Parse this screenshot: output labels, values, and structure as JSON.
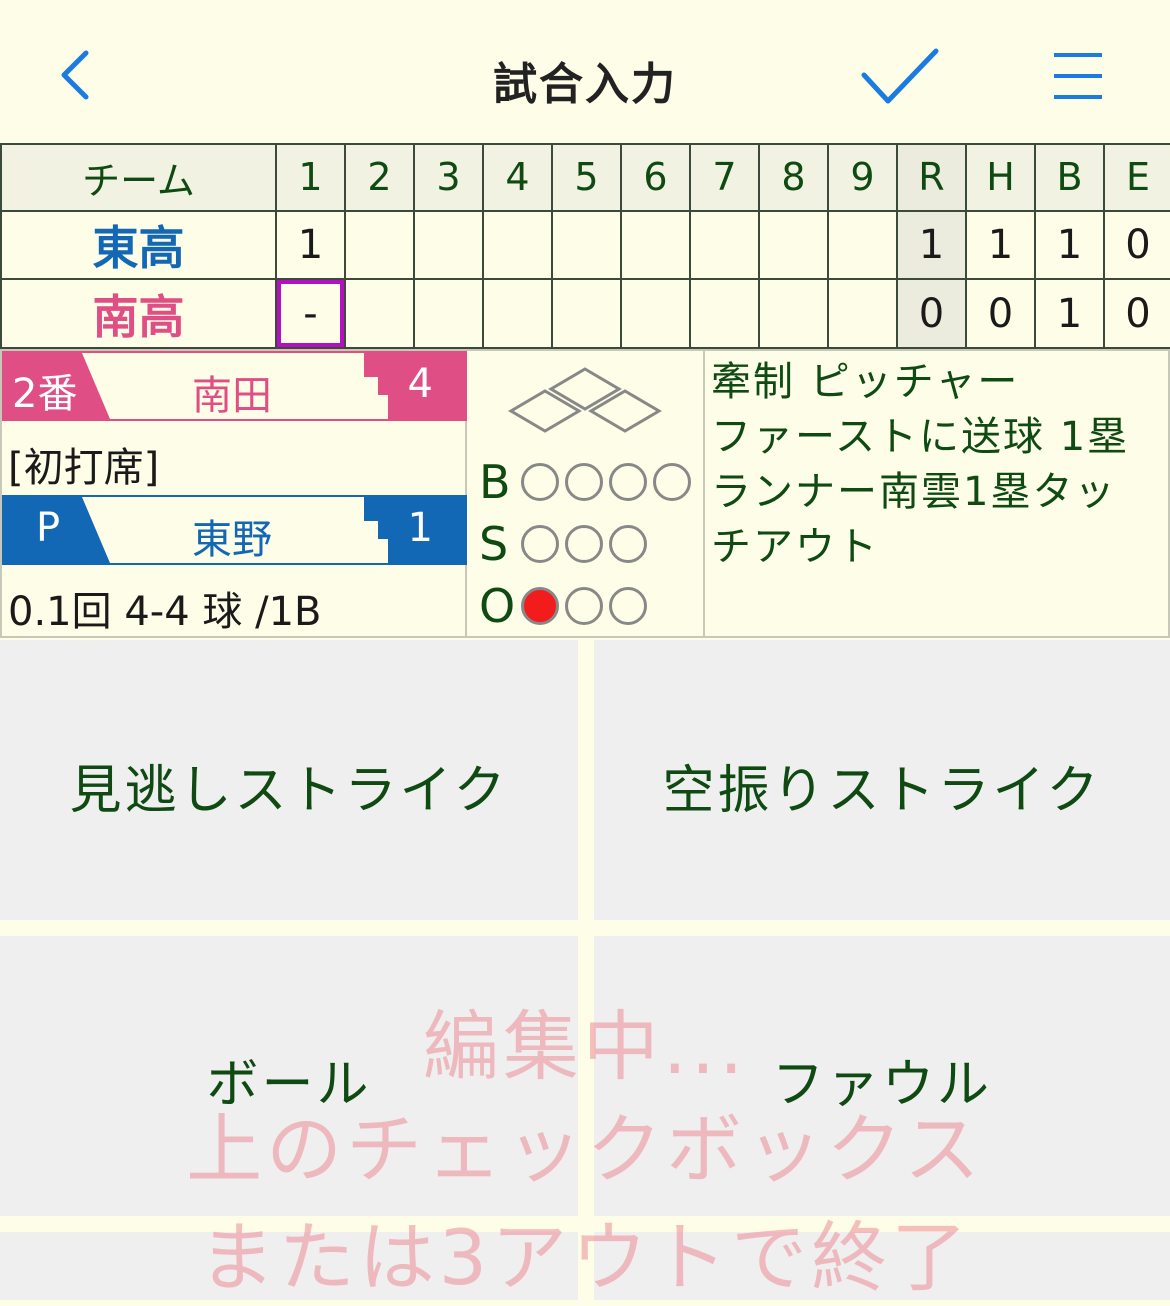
{
  "nav": {
    "title": "試合入力",
    "back_icon": "chevron-left-icon",
    "confirm_icon": "checkmark-icon",
    "menu_icon": "hamburger-menu-icon"
  },
  "scoreboard": {
    "headers": [
      "チーム",
      "1",
      "2",
      "3",
      "4",
      "5",
      "6",
      "7",
      "8",
      "9",
      "R",
      "H",
      "B",
      "E"
    ],
    "rows": [
      {
        "team": "東高",
        "innings": [
          "1",
          "",
          "",
          "",
          "",
          "",
          "",
          "",
          ""
        ],
        "R": "1",
        "H": "1",
        "B": "1",
        "E": "0"
      },
      {
        "team": "南高",
        "innings": [
          "-",
          "",
          "",
          "",
          "",
          "",
          "",
          "",
          ""
        ],
        "R": "0",
        "H": "0",
        "B": "1",
        "E": "0"
      }
    ]
  },
  "batter": {
    "order": "2番",
    "name": "南田",
    "position": "4",
    "note": "[初打席]"
  },
  "pitcher": {
    "label": "P",
    "name": "東野",
    "number": "1",
    "stats": "0.1回 4-4 球 /1B"
  },
  "count": {
    "labels": {
      "ball": "B",
      "strike": "S",
      "out": "O"
    },
    "balls": 0,
    "strikes": 0,
    "outs": 1,
    "ball_slots": 4,
    "strike_slots": 3,
    "out_slots": 3
  },
  "play_text": [
    "牽制 ピッチャー",
    "ファーストに送球 1塁",
    "ランナー南雲1塁タッ",
    "チアウト"
  ],
  "actions": {
    "called_strike": "見逃しストライク",
    "swinging_strike": "空振りストライク",
    "ball": "ボール",
    "foul": "ファウル"
  },
  "overlay": {
    "line1": "編集中...",
    "line2": "上のチェックボックス",
    "line3": "または3アウトで終了"
  },
  "colors": {
    "away": "#1268b4",
    "home": "#df4f86",
    "text_green": "#0f4a12",
    "accent_blue": "#1a7be0",
    "selected": "#b40fc0",
    "out_dot": "#f21c1c"
  }
}
